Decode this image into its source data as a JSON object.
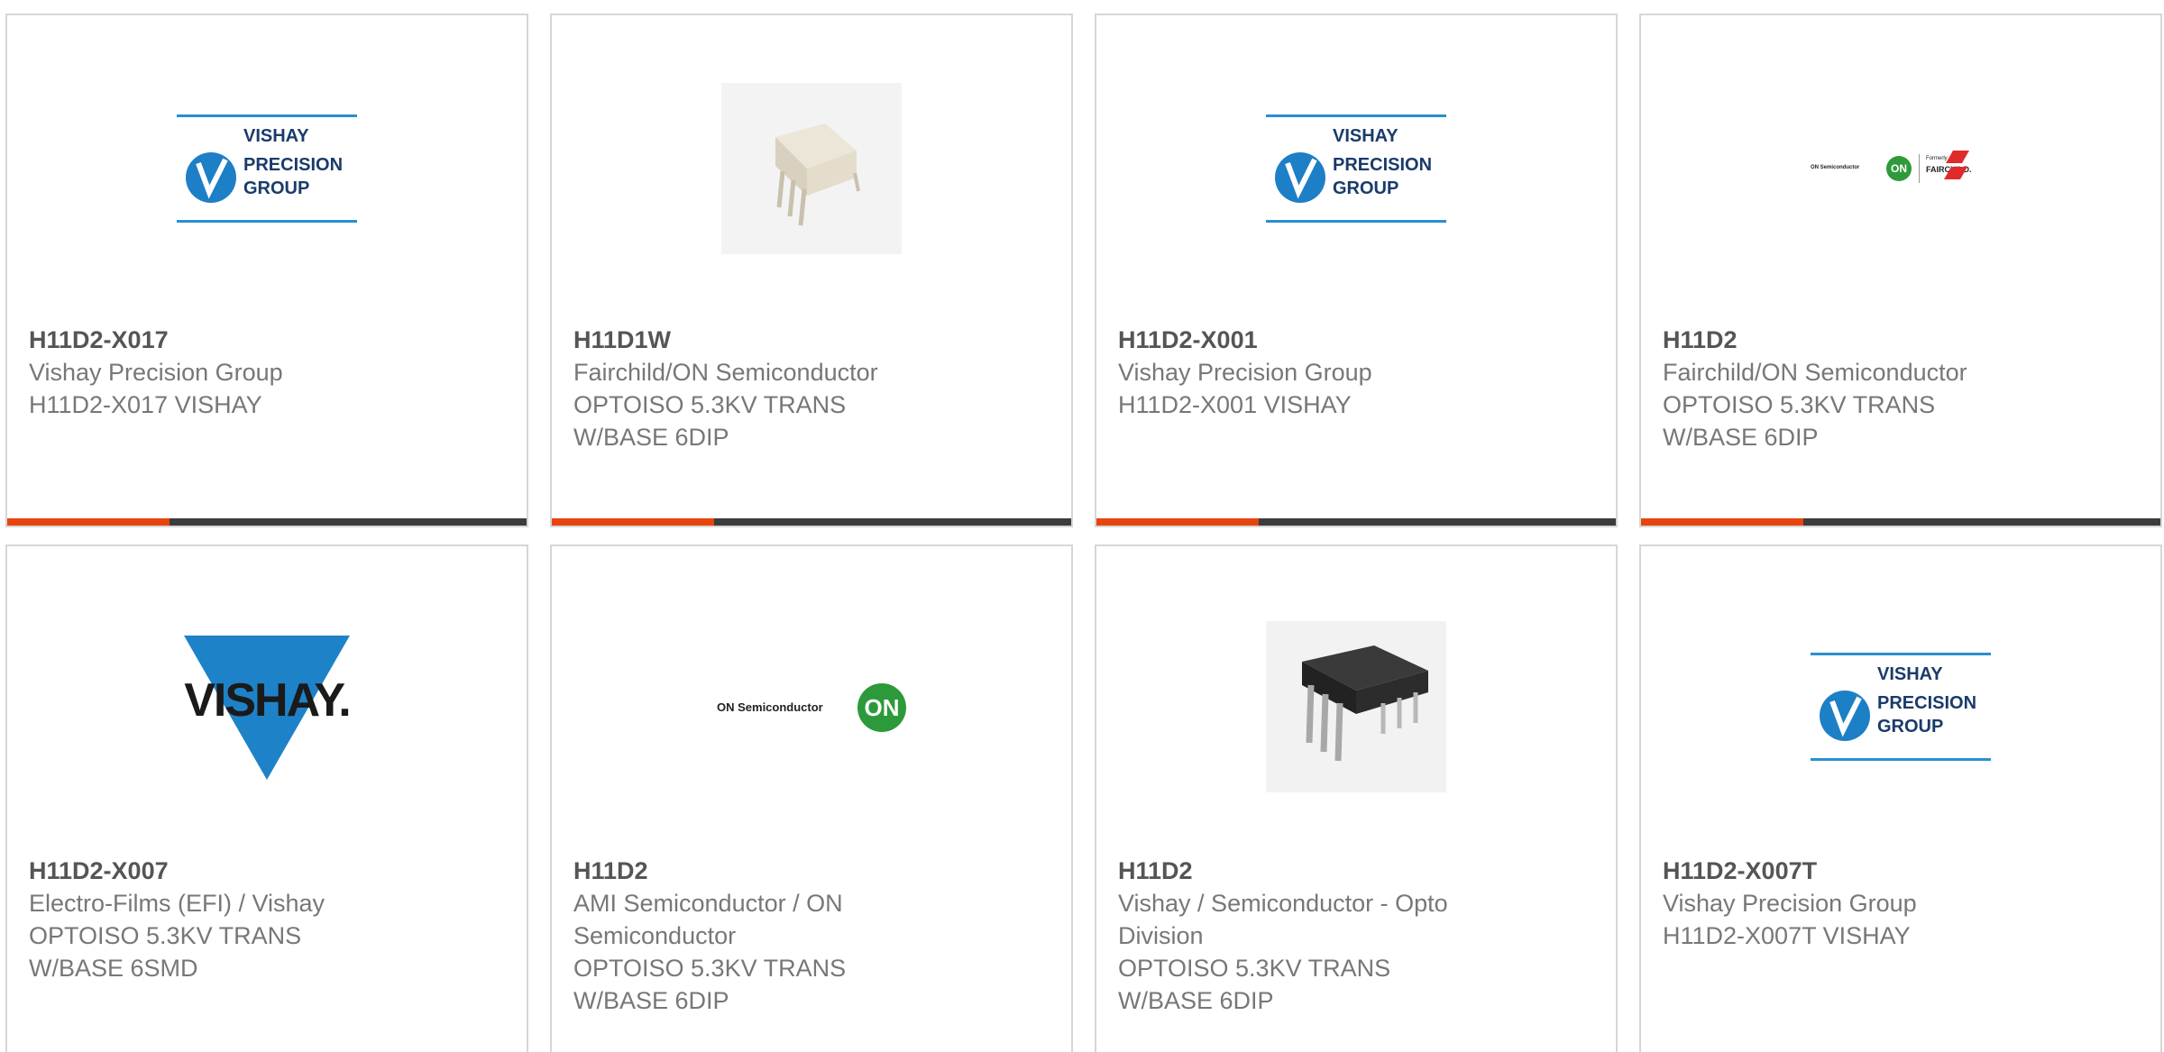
{
  "logos": {
    "vpg_line1": "VISHAY",
    "vpg_line2": "PRECISION",
    "vpg_line3": "GROUP",
    "vishay": "VISHAY.",
    "on_semi": "ON Semiconductor",
    "on": "ON",
    "formerly": "Formerly",
    "fairchild": "FAIRCHILD."
  },
  "products": [
    {
      "part": "H11D2-X017",
      "manufacturer": "Vishay Precision Group",
      "desc1": "H11D2-X017 VISHAY",
      "desc2": ""
    },
    {
      "part": "H11D1W",
      "manufacturer": "Fairchild/ON Semiconductor",
      "desc1": "OPTOISO 5.3KV TRANS",
      "desc2": "W/BASE 6DIP"
    },
    {
      "part": "H11D2-X001",
      "manufacturer": "Vishay Precision Group",
      "desc1": "H11D2-X001 VISHAY",
      "desc2": ""
    },
    {
      "part": "H11D2",
      "manufacturer": "Fairchild/ON Semiconductor",
      "desc1": "OPTOISO 5.3KV TRANS",
      "desc2": "W/BASE 6DIP"
    },
    {
      "part": "H11D2-X007",
      "manufacturer": "Electro-Films (EFI) / Vishay",
      "desc1": "OPTOISO 5.3KV TRANS",
      "desc2": "W/BASE 6SMD"
    },
    {
      "part": "H11D2",
      "manufacturer_line1": "AMI Semiconductor / ON",
      "manufacturer_line2": "Semiconductor",
      "desc1": "OPTOISO 5.3KV TRANS",
      "desc2": "W/BASE 6DIP"
    },
    {
      "part": "H11D2",
      "manufacturer_line1": "Vishay / Semiconductor - Opto",
      "manufacturer_line2": "Division",
      "desc1": "OPTOISO 5.3KV TRANS",
      "desc2": "W/BASE 6DIP"
    },
    {
      "part": "H11D2-X007T",
      "manufacturer": "Vishay Precision Group",
      "desc1": "H11D2-X007T VISHAY",
      "desc2": ""
    }
  ],
  "colors": {
    "accent": "#e8440e",
    "bar": "#3c3c3c",
    "vishay_blue": "#1d7fc6",
    "on_green": "#2f9a3b"
  }
}
